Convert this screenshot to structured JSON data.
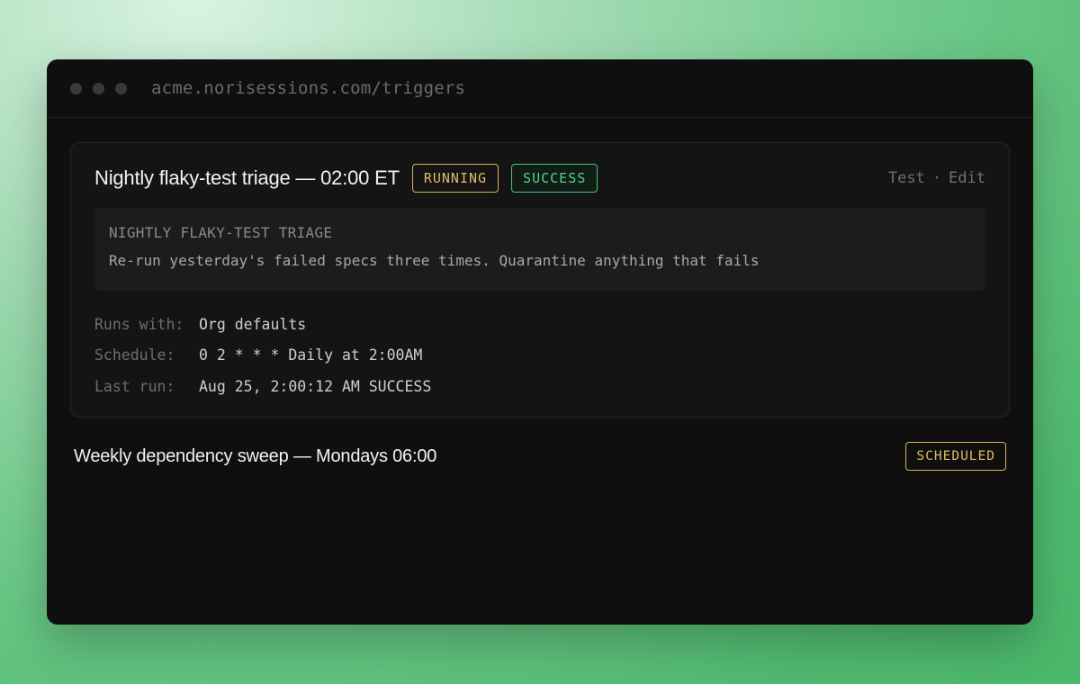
{
  "window": {
    "url": "acme.norisessions.com/triggers"
  },
  "triggers": [
    {
      "title": "Nightly flaky-test triage — 02:00 ET",
      "badges": [
        "RUNNING",
        "SUCCESS"
      ],
      "actions": {
        "test": "Test",
        "separator": "·",
        "edit": "Edit"
      },
      "prompt": {
        "title": "NIGHTLY FLAKY-TEST TRIAGE",
        "text": "Re-run yesterday's failed specs three times. Quarantine anything that fails"
      },
      "meta": [
        {
          "label": "Runs with:",
          "value": "Org defaults"
        },
        {
          "label": "Schedule:",
          "value": "0 2 * * * Daily at 2:00AM"
        },
        {
          "label": "Last run:",
          "value": "Aug 25, 2:00:12 AM SUCCESS"
        }
      ]
    },
    {
      "title": "Weekly dependency sweep — Mondays 06:00",
      "badges": [
        "SCHEDULED"
      ]
    }
  ],
  "colors": {
    "running": "#e0bd60",
    "success": "#5bd08a",
    "scheduled": "#e0bd60"
  }
}
